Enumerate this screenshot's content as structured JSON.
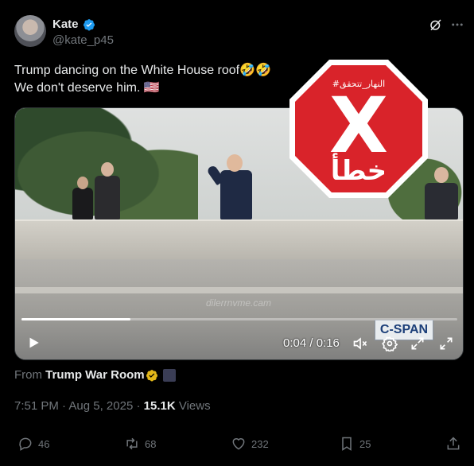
{
  "author": {
    "name": "Kate",
    "handle": "@kate_p45"
  },
  "tweet": {
    "line1": "Trump dancing on the White House roof🤣🤣",
    "line2": "We don't deserve him. 🇺🇸"
  },
  "video": {
    "time": "0:04 / 0:16",
    "progress": 0.25,
    "watermark": "dilerrnvme.cam",
    "network_logo": "C-SPAN"
  },
  "factcheck": {
    "tag": "#النهار_تتحقق",
    "verdict": "خطأ",
    "mark": "X",
    "color": "#d9232a"
  },
  "source": {
    "prefix": "From",
    "name": "Trump War Room"
  },
  "meta": {
    "time": "7:51 PM",
    "sep": "·",
    "date": "Aug 5, 2025",
    "views_count": "15.1K",
    "views_label": "Views"
  },
  "actions": {
    "replies": "46",
    "reposts": "68",
    "likes": "232",
    "bookmarks": "25"
  },
  "icons": [
    "verified-icon",
    "grok-icon",
    "more-icon",
    "play-icon",
    "mute-icon",
    "settings-icon",
    "pip-icon",
    "fullscreen-icon",
    "reply-icon",
    "repost-icon",
    "like-icon",
    "bookmark-icon",
    "share-icon"
  ],
  "colors": {
    "verified_blue": "#1d9bf0",
    "affiliate_gold": "#e2b719",
    "muted_text": "#71767b"
  }
}
